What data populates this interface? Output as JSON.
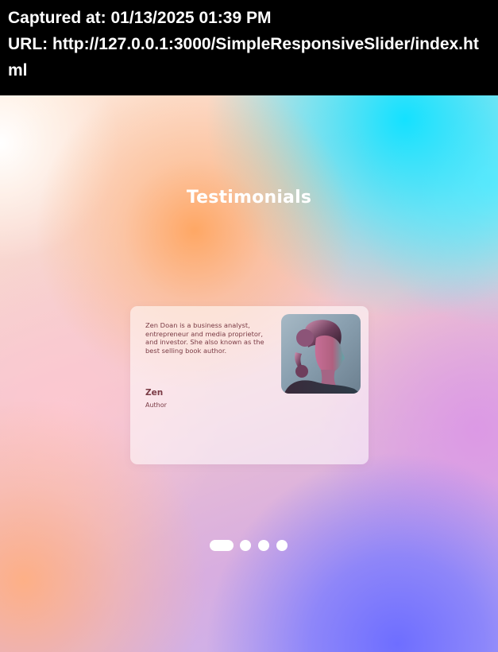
{
  "capture": {
    "captured_at": "Captured at: 01/13/2025 01:39 PM",
    "url": "URL: http://127.0.0.1:3000/SimpleResponsiveSlider/index.html"
  },
  "page": {
    "title": "Testimonials"
  },
  "testimonial": {
    "quote": "Zen Doan is a business analyst, entrepreneur and media proprietor, and investor. She also known as the best selling book author.",
    "name": "Zen",
    "role": "Author",
    "avatar_icon": "portrait-photo-icon"
  },
  "pagination": {
    "count": 4,
    "active_index": 0
  },
  "colors": {
    "text_accent": "#7a3b45",
    "title": "#ffffff",
    "dot": "#ffffff"
  }
}
